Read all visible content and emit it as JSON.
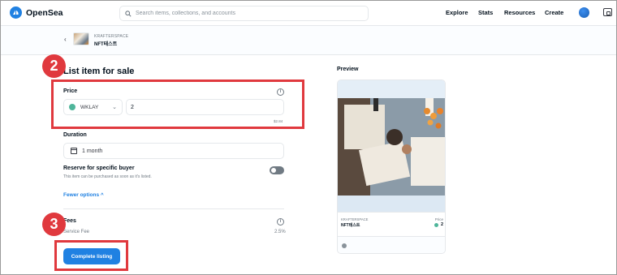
{
  "header": {
    "brand": "OpenSea",
    "search_placeholder": "Search items, collections, and accounts",
    "nav": [
      "Explore",
      "Stats",
      "Resources",
      "Create"
    ]
  },
  "subheader": {
    "back_icon": "chevron-left-icon",
    "collection": "KRAFTERSPACE",
    "item_name": "NFT테스트"
  },
  "form": {
    "title": "List item for sale",
    "price_label": "Price",
    "currency": "WKLAY",
    "amount": "2",
    "usd_value": "$2.84",
    "duration_label": "Duration",
    "duration_value": "1 month",
    "reserve_label": "Reserve for specific buyer",
    "reserve_sub": "This item can be purchased as soon as it's listed.",
    "reserve_enabled": false,
    "fewer_options": "Fewer options",
    "fees_label": "Fees",
    "service_fee_label": "Service Fee",
    "service_fee_value": "2.5%",
    "complete_button": "Complete listing"
  },
  "preview": {
    "label": "Preview",
    "collection": "KRAFTERSPACE",
    "name": "NFT테스트",
    "price_label": "Price",
    "price_value": "2"
  },
  "annotations": {
    "step2": "2",
    "step3": "3",
    "highlight_color": "#e0393e"
  },
  "colors": {
    "accent": "#2081e2",
    "klay": "#4fb59a"
  }
}
